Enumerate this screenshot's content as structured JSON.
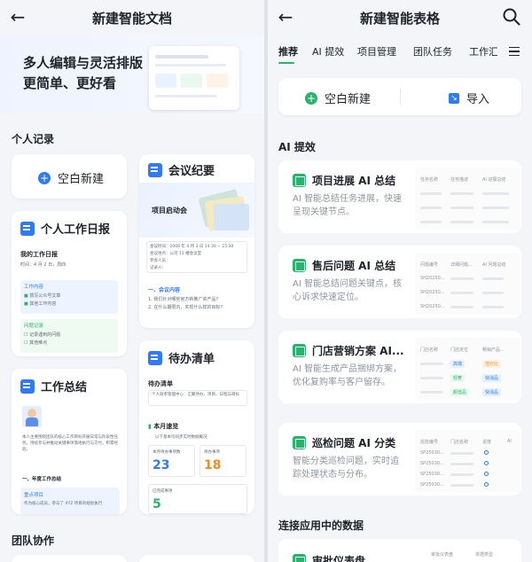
{
  "left": {
    "title": "新建智能文档",
    "hero": {
      "line1": "多人编辑与灵活排版",
      "line2": "更简单、更好看"
    },
    "section_personal": "个人记录",
    "blank_label": "空白新建",
    "meeting": {
      "title": "会议纪要",
      "cover": "项目启动会",
      "time": "会议时间：2008 年 4 月 3 日 14:30 ~ 15:30",
      "place": "会议地点：公司 11 楼会议室",
      "people": "参会人员：",
      "recorder": "记录人：",
      "s1": "一、会议内容",
      "i1": "1. 我们针对哪些官方新推广资产品?",
      "i2": "2. 在什么期限内，实现什么样的目标?"
    },
    "daily": {
      "title": "个人工作日报",
      "sub": "我的工作日报",
      "time": "时间：4 月 2 日，周四",
      "box1": "工作内容",
      "b1a": "撰写公众号文章",
      "b1b": "其他工作内容",
      "box2": "问题记录",
      "b2a": "记录遇到的问题",
      "b2b": "其他难点"
    },
    "todo": {
      "title": "待办清单",
      "sub": "待办清单",
      "desc": "个人效率管理中心：汇聚待办、项目、日程与目标",
      "month": "本月速览",
      "hint": "以下基本均同步实时数据概况",
      "k1": "本月待办事项数",
      "v1": "23",
      "k2": "待办事项",
      "v2": "18",
      "k3": "已完成事项",
      "v3": "5"
    },
    "summary": {
      "title": "工作总结",
      "body": "本人主要围绕团队的核心工作目标开展日常与阶段性任务。持续参与并推动关键事项落地执行与交付，积累经验。",
      "s1": "一、年度工作总结",
      "h1": "重点项目",
      "p1": "作为核心成员，参与了 XYZ 项目的规划执行"
    },
    "section_team": "团队协作"
  },
  "right": {
    "title": "新建智能表格",
    "tabs": [
      "推荐",
      "AI 提效",
      "项目管理",
      "团队任务",
      "工作汇"
    ],
    "blank_label": "空白新建",
    "import_label": "导入",
    "section_ai": "AI 提效",
    "cards": [
      {
        "title": "项目进展 AI 总结",
        "desc": "AI 智能总结任务进展，快速呈现关键节点。",
        "cols": [
          "任务名称",
          "任务描述",
          "AI 进展总结"
        ]
      },
      {
        "title": "售后问题 AI 总结",
        "desc": "AI 智能总结问题关键点，核心诉求快速定位。",
        "cols": [
          "问题编号",
          "详细问题...",
          "AI 问题总结"
        ],
        "rows": [
          "SH20250...",
          "SH20250...",
          "SH20250..."
        ]
      },
      {
        "title": "门店营销方案 AI...",
        "desc": "AI 智能生成产品捆绑方案，优化复购率与客户留存。",
        "cols": [
          "门店名称",
          "门店定位",
          "畅销产品..."
        ],
        "tags": [
          "高端",
          "性价比",
          "轻奢",
          "快消品",
          "颜值品",
          "快消品"
        ]
      },
      {
        "title": "巡检问题 AI 分类",
        "desc": "智能分类巡检问题，实时追踪处理状态与分布。",
        "cols": [
          "巡检编号",
          "门店名称",
          "进度",
          "AI"
        ],
        "rows": [
          "SP25030...",
          "SP25030...",
          "SP25030...",
          "SP25030..."
        ]
      }
    ],
    "section_connect": "连接应用中的数据",
    "bottom_title": "审批仪表盘",
    "bottom_cols": [
      "审批仪表盘",
      "单据类型"
    ]
  }
}
